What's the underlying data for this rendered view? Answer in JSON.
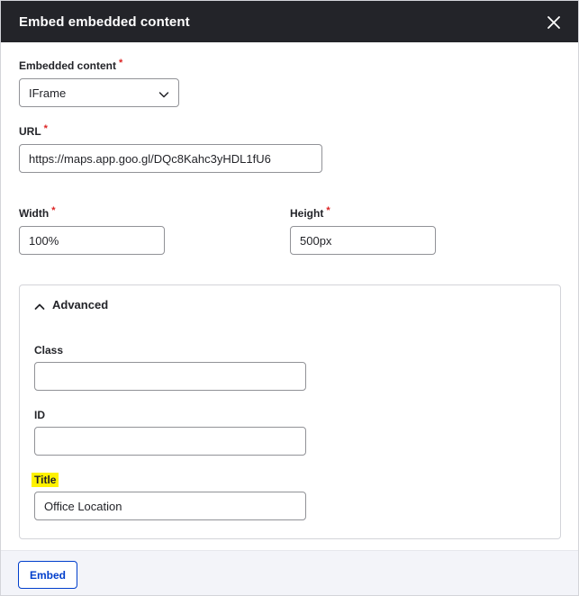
{
  "dialog": {
    "title": "Embed embedded content",
    "close_icon": "close-icon"
  },
  "form": {
    "embedded_content": {
      "label": "Embedded content",
      "required_mark": "*",
      "value": "IFrame"
    },
    "url": {
      "label": "URL",
      "required_mark": "*",
      "value": "https://maps.app.goo.gl/DQc8Kahc3yHDL1fU6"
    },
    "width": {
      "label": "Width",
      "required_mark": "*",
      "value": "100%"
    },
    "height": {
      "label": "Height",
      "required_mark": "*",
      "value": "500px"
    },
    "advanced": {
      "summary": "Advanced",
      "class": {
        "label": "Class",
        "value": ""
      },
      "id": {
        "label": "ID",
        "value": ""
      },
      "title": {
        "label": "Title",
        "value": "Office Location"
      }
    }
  },
  "footer": {
    "embed_label": "Embed"
  },
  "colors": {
    "titlebar": "#232429",
    "required": "#dc2323",
    "primary": "#003ecc",
    "highlight": "#fff200"
  }
}
